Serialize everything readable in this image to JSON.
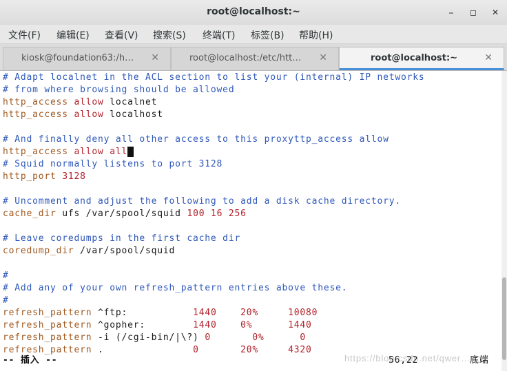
{
  "window": {
    "title": "root@localhost:~",
    "minimize": "⎯",
    "maximize": "◻",
    "close": "✕"
  },
  "menu": [
    "文件(F)",
    "编辑(E)",
    "查看(V)",
    "搜索(S)",
    "终端(T)",
    "标签(B)",
    "帮助(H)"
  ],
  "tabs": [
    {
      "label": "kiosk@foundation63:/h…",
      "close": "✕"
    },
    {
      "label": "root@localhost:/etc/htt…",
      "close": "✕"
    },
    {
      "label": "root@localhost:~",
      "close": "✕"
    }
  ],
  "lines": [
    [
      [
        "c",
        "# Adapt localnet in the ACL section to list your (internal) IP networks"
      ]
    ],
    [
      [
        "c",
        "# from where browsing should be allowed"
      ]
    ],
    [
      [
        "k",
        "http_access "
      ],
      [
        "n",
        "allow"
      ],
      [
        "t",
        " localnet"
      ]
    ],
    [
      [
        "k",
        "http_access "
      ],
      [
        "n",
        "allow"
      ],
      [
        "t",
        " localhost"
      ]
    ],
    [],
    [
      [
        "c",
        "# And finally deny all other access to this proxyttp_access allow"
      ]
    ],
    [
      [
        "k",
        "http_access "
      ],
      [
        "n",
        "allow all"
      ]
    ],
    [
      [
        "c",
        "# Squid normally listens to port 3128"
      ]
    ],
    [
      [
        "k",
        "http_port "
      ],
      [
        "n",
        "3128"
      ]
    ],
    [],
    [
      [
        "c",
        "# Uncomment and adjust the following to add a disk cache directory."
      ]
    ],
    [
      [
        "k",
        "cache_dir"
      ],
      [
        "t",
        " ufs /var/spool/squid "
      ],
      [
        "n",
        "100 16 256"
      ]
    ],
    [],
    [
      [
        "c",
        "# Leave coredumps in the first cache dir"
      ]
    ],
    [
      [
        "k",
        "coredump_dir"
      ],
      [
        "t",
        " /var/spool/squid"
      ]
    ],
    [],
    [
      [
        "c",
        "#"
      ]
    ],
    [
      [
        "c",
        "# Add any of your own refresh_pattern entries above these."
      ]
    ],
    [
      [
        "c",
        "#"
      ]
    ],
    [
      [
        "k",
        "refresh_pattern"
      ],
      [
        "t",
        " ^ftp:           "
      ],
      [
        "n",
        "1440    20%     10080"
      ]
    ],
    [
      [
        "k",
        "refresh_pattern"
      ],
      [
        "t",
        " ^gopher:        "
      ],
      [
        "n",
        "1440    0%      1440"
      ]
    ],
    [
      [
        "k",
        "refresh_pattern"
      ],
      [
        "t",
        " -i (/cgi-bin/|\\?) "
      ],
      [
        "n",
        "0       0%      0"
      ]
    ],
    [
      [
        "k",
        "refresh_pattern"
      ],
      [
        "t",
        " .               "
      ],
      [
        "n",
        "0       20%     4320"
      ]
    ]
  ],
  "status": {
    "mode": "-- 插入 --",
    "position": "56,22",
    "scroll": "底端"
  },
  "watermark": "https://blog.csdn.net/qwer…"
}
